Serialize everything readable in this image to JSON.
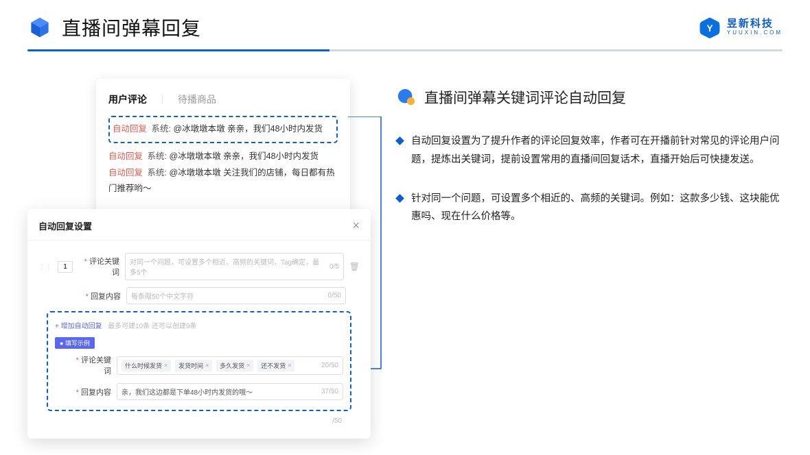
{
  "header": {
    "title": "直播间弹幕回复",
    "brand_cn": "昱新科技",
    "brand_en": "YUUXIN.COM"
  },
  "comments_card": {
    "tabs": {
      "active": "用户评论",
      "inactive": "待播商品"
    },
    "rows": [
      {
        "tag": "自动回复",
        "sys": "系统:",
        "text": "@冰墩墩本墩 亲亲，我们48小时内发货"
      },
      {
        "tag": "自动回复",
        "sys": "系统:",
        "text": "@冰墩墩本墩 亲亲，我们48小时内发货"
      },
      {
        "tag": "自动回复",
        "sys": "系统:",
        "text": "@冰墩墩本墩 关注我们的店铺，每日都有热门推荐哟～"
      }
    ]
  },
  "settings_card": {
    "title": "自动回复设置",
    "num": "1",
    "keyword_label": "评论关键词",
    "keyword_placeholder": "对同一个问题，可设置多个相近、高频的关键词，Tag确定，最多5个",
    "keyword_counter": "0/5",
    "content_label": "回复内容",
    "content_placeholder": "每条限50个中文字符",
    "content_counter": "0/50",
    "add_link": "+ 增加自动回复",
    "add_hint": "最多可建10条 还可以创建9条",
    "example_badge": "● 填写示例",
    "example_keyword_label": "评论关键词",
    "example_tags": [
      "什么时候发货",
      "发货时间",
      "多久发货",
      "还不发货"
    ],
    "example_kw_counter": "20/50",
    "example_content_label": "回复内容",
    "example_content": "亲，我们这边都是下单48小时内发货的哦～",
    "example_counter": "37/50",
    "footer_counter": "/50"
  },
  "right": {
    "section_title": "直播间弹幕关键词评论自动回复",
    "bullets": [
      "自动回复设置为了提升作者的评论回复效率，作者可在开播前针对常见的评论用户问题，提炼出关键词，提前设置常用的直播间回复话术，直播开始后可快捷发送。",
      "针对同一个问题，可设置多个相近的、高频的关键词。例如：这款多少钱、这块能优惠吗、现在什么价格等。"
    ]
  }
}
